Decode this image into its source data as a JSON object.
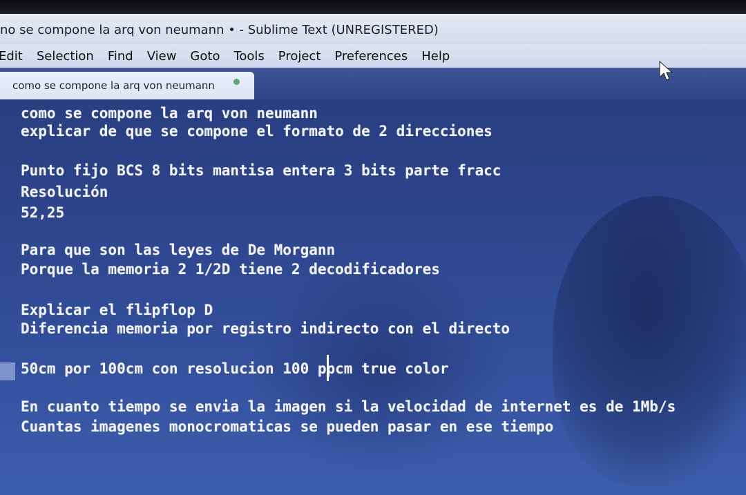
{
  "window": {
    "title": "no se compone la arq von neumann • - Sublime Text (UNREGISTERED)"
  },
  "menu": {
    "items": [
      "Edit",
      "Selection",
      "Find",
      "View",
      "Goto",
      "Tools",
      "Project",
      "Preferences",
      "Help"
    ]
  },
  "tab": {
    "label": "como se compone la arq von neumann",
    "unsaved_dot_color": "#58a86c"
  },
  "editor": {
    "lines": [
      "como se compone la arq von neumann",
      "explicar de que se compone el formato de 2 direcciones",
      "Punto fijo BCS 8 bits mantisa entera 3 bits parte fracc",
      "Resolución",
      "52,25",
      "Para que son las leyes de De Morgann",
      "Porque la memoria 2 1/2D tiene 2 decodificadores",
      "Explicar el flipflop D",
      "Diferencia memoria por registro indirecto con el directo",
      "50cm por 100cm con resolucion 100 ppcm true color",
      "En cuanto tiempo se envia la imagen si la velocidad de internet es de 1Mb/s",
      "Cuantas imagenes monocromaticas se pueden pasar en ese tiempo"
    ],
    "text_color": "#f2f4fa",
    "background_color": "#2c438a"
  },
  "icons": {
    "mouse_pointer": "mouse-pointer-icon",
    "unsaved": "unsaved-dot-icon"
  }
}
